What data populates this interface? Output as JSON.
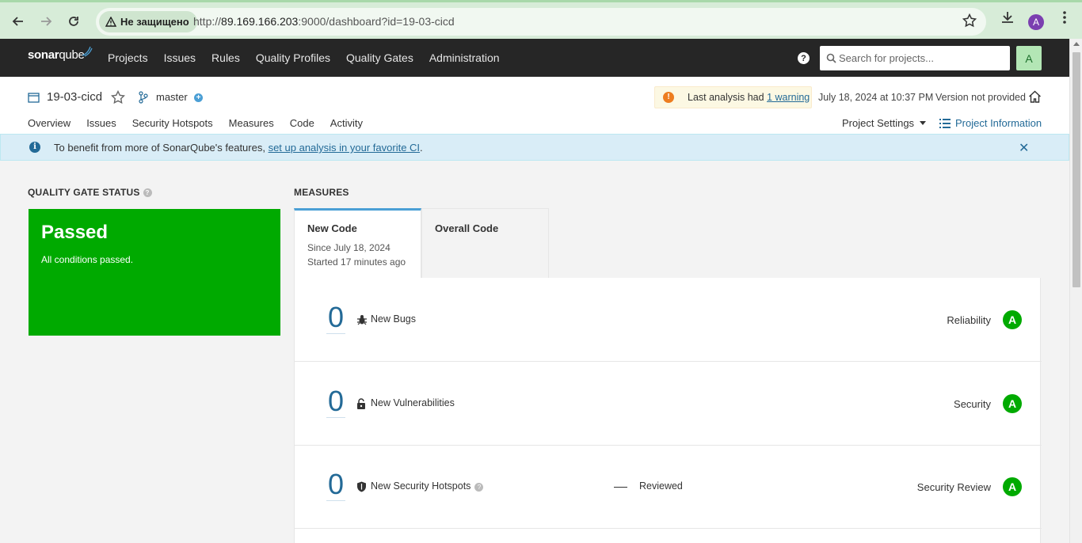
{
  "browser": {
    "security_label": "Не защищено",
    "url_prefix": "http://",
    "url_host": "89.169.166.203",
    "url_rest": ":9000/dashboard?id=19-03-cicd",
    "profile_initial": "A"
  },
  "topnav": {
    "logo_bold": "sonar",
    "logo_light": "qube",
    "items": [
      "Projects",
      "Issues",
      "Rules",
      "Quality Profiles",
      "Quality Gates",
      "Administration"
    ],
    "help_label": "?",
    "search_placeholder": "Search for projects...",
    "avatar_initial": "A"
  },
  "project": {
    "name": "19-03-cicd",
    "branch": "master",
    "warning_prefix": "Last analysis had ",
    "warning_link": "1 warning",
    "analysis_date": "July 18, 2024 at 10:37 PM",
    "version": "Version not provided",
    "tabs": [
      "Overview",
      "Issues",
      "Security Hotspots",
      "Measures",
      "Code",
      "Activity"
    ],
    "active_tab": "Overview",
    "settings_label": "Project Settings",
    "info_label": "Project Information"
  },
  "banner": {
    "text": "To benefit from more of SonarQube's features, ",
    "link": "set up analysis in your favorite CI",
    "suffix": "."
  },
  "quality_gate": {
    "title": "QUALITY GATE STATUS",
    "status": "Passed",
    "message": "All conditions passed.",
    "color": "#00aa00"
  },
  "measures": {
    "title": "MEASURES",
    "tabs": [
      {
        "label": "New Code",
        "line1": "Since July 18, 2024",
        "line2": "Started 17 minutes ago"
      },
      {
        "label": "Overall Code"
      }
    ],
    "rows": [
      {
        "value": "0",
        "icon": "bug-icon",
        "label": "New Bugs",
        "category": "Reliability",
        "grade": "A"
      },
      {
        "value": "0",
        "icon": "lock-icon",
        "label": "New Vulnerabilities",
        "category": "Security",
        "grade": "A"
      },
      {
        "value": "0",
        "icon": "shield-icon",
        "label": "New Security Hotspots",
        "reviewed_value": "—",
        "reviewed_label": "Reviewed",
        "category": "Security Review",
        "grade": "A"
      }
    ]
  }
}
